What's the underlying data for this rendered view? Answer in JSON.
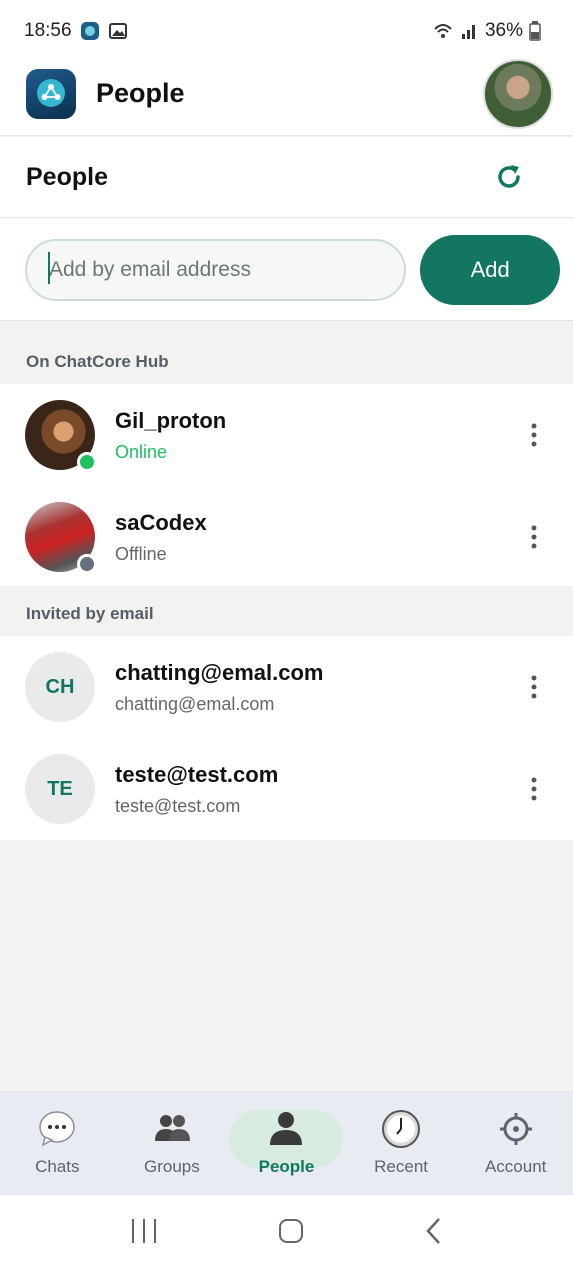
{
  "status_bar": {
    "time": "18:56",
    "battery": "36%"
  },
  "app_bar": {
    "title": "People"
  },
  "section": {
    "title": "People"
  },
  "add_form": {
    "placeholder": "Add by email address",
    "button_label": "Add"
  },
  "groups": [
    {
      "label": "On ChatCore Hub",
      "items": [
        {
          "name": "Gil_proton",
          "sub": "Online",
          "status": "online"
        },
        {
          "name": "saCodex",
          "sub": "Offline",
          "status": "offline"
        }
      ]
    },
    {
      "label": "Invited by email",
      "items": [
        {
          "initials": "CH",
          "name": "chatting@emal.com",
          "sub": "chatting@emal.com"
        },
        {
          "initials": "TE",
          "name": "teste@test.com",
          "sub": "teste@test.com"
        }
      ]
    }
  ],
  "bottom_nav": [
    {
      "label": "Chats",
      "icon": "chat-bubble-icon"
    },
    {
      "label": "Groups",
      "icon": "groups-icon"
    },
    {
      "label": "People",
      "icon": "person-icon",
      "active": true
    },
    {
      "label": "Recent",
      "icon": "clock-icon"
    },
    {
      "label": "Account",
      "icon": "gear-icon"
    }
  ],
  "colors": {
    "accent": "#127660",
    "online": "#1ec060",
    "offline": "#666f7a"
  }
}
